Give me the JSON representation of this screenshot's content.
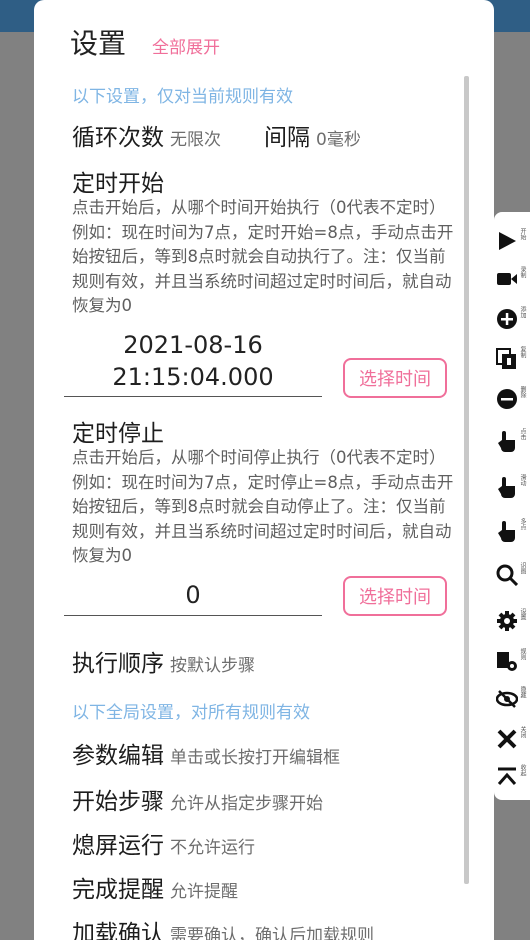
{
  "dialog": {
    "title": "设置",
    "expand_all": "全部展开"
  },
  "current_rule_section": "以下设置，仅对当前规则有效",
  "loop": {
    "label": "循环次数",
    "value": "无限次"
  },
  "interval": {
    "label": "间隔",
    "value": "0毫秒"
  },
  "timed_start": {
    "label": "定时开始",
    "desc": "点击开始后，从哪个时间开始执行（0代表不定时）例如：现在时间为7点，定时开始=8点，手动点击开始按钮后，等到8点时就会自动执行了。注：仅当前规则有效，并且当系统时间超过定时时间后，就自动恢复为0",
    "date": "2021-08-16",
    "time": "21:15:04.000",
    "button": "选择时间"
  },
  "timed_stop": {
    "label": "定时停止",
    "desc": "点击开始后，从哪个时间停止执行（0代表不定时）例如：现在时间为7点，定时停止=8点，手动点击开始按钮后，等到8点时就会自动停止了。注：仅当前规则有效，并且当系统时间超过定时时间后，就自动恢复为0",
    "value": "0",
    "button": "选择时间"
  },
  "exec_order": {
    "label": "执行顺序",
    "value": "按默认步骤"
  },
  "global_section": "以下全局设置，对所有规则有效",
  "param_edit": {
    "label": "参数编辑",
    "value": "单击或长按打开编辑框"
  },
  "start_step": {
    "label": "开始步骤",
    "value": "允许从指定步骤开始"
  },
  "screen_off": {
    "label": "熄屏运行",
    "value": "不允许运行"
  },
  "finish_remind": {
    "label": "完成提醒",
    "value": "允许提醒"
  },
  "load_confirm": {
    "label": "加载确认",
    "value": "需要确认，确认后加载规则"
  },
  "tools": [
    {
      "icon": "play-icon",
      "label": "开始"
    },
    {
      "icon": "record-icon",
      "label": "录制"
    },
    {
      "icon": "add-icon",
      "label": "添加"
    },
    {
      "icon": "copy-icon",
      "label": "复制"
    },
    {
      "icon": "remove-icon",
      "label": "删除"
    },
    {
      "icon": "tap-icon",
      "label": "点击"
    },
    {
      "icon": "swipe-icon",
      "label": "滑动"
    },
    {
      "icon": "multi-tap-icon",
      "label": "多点"
    },
    {
      "icon": "recognize-icon",
      "label": "识图"
    },
    {
      "icon": "settings-icon",
      "label": "设置"
    },
    {
      "icon": "rules-icon",
      "label": "规则"
    },
    {
      "icon": "hide-icon",
      "label": "隐藏"
    },
    {
      "icon": "close-icon",
      "label": "关闭"
    },
    {
      "icon": "collapse-icon",
      "label": "收起"
    }
  ]
}
